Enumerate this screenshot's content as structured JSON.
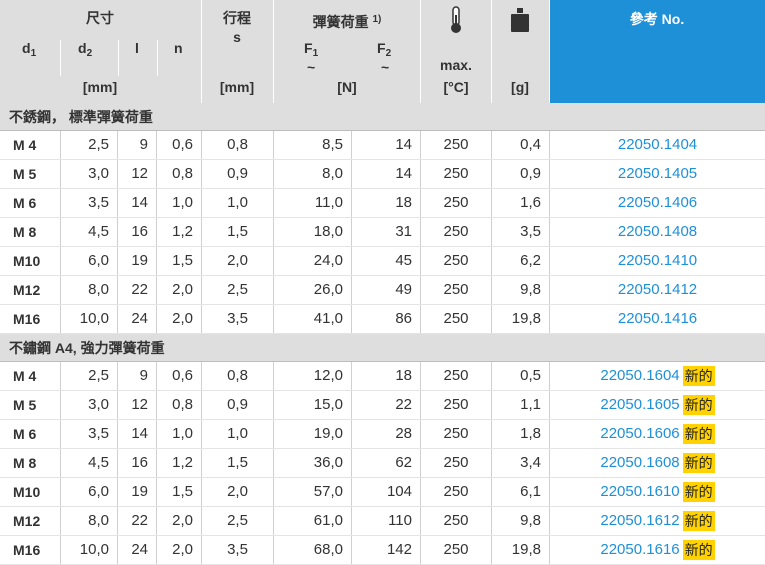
{
  "header": {
    "dim_group": "尺寸",
    "d1": "d",
    "d1_sub": "1",
    "d2": "d",
    "d2_sub": "2",
    "l": "l",
    "n": "n",
    "mm_unit": "[mm]",
    "stroke_title": "行程",
    "stroke_sym": "s",
    "stroke_unit": "[mm]",
    "spring_title": "彈簧荷重",
    "spring_sup": "1)",
    "f1": "F",
    "f1_sub": "1",
    "f1_tilde": "~",
    "f2": "F",
    "f2_sub": "2",
    "f2_tilde": "~",
    "n_unit": "[N]",
    "max_label": "max.",
    "temp_unit": "[°C]",
    "weight_unit": "[g]",
    "ref_title": "參考 No.",
    "temp_icon": "thermometer-icon",
    "weight_icon": "weight-icon"
  },
  "new_badge": "新的",
  "sections": [
    {
      "title": "不銹鋼， 標準彈簧荷重",
      "rows": [
        {
          "size": "M 4",
          "d2": "2,5",
          "l": "9",
          "n": "0,6",
          "s": "0,8",
          "f1": "8,5",
          "f2": "14",
          "t": "250",
          "g": "0,4",
          "ref": "22050.1404",
          "new": false
        },
        {
          "size": "M 5",
          "d2": "3,0",
          "l": "12",
          "n": "0,8",
          "s": "0,9",
          "f1": "8,0",
          "f2": "14",
          "t": "250",
          "g": "0,9",
          "ref": "22050.1405",
          "new": false
        },
        {
          "size": "M 6",
          "d2": "3,5",
          "l": "14",
          "n": "1,0",
          "s": "1,0",
          "f1": "11,0",
          "f2": "18",
          "t": "250",
          "g": "1,6",
          "ref": "22050.1406",
          "new": false
        },
        {
          "size": "M 8",
          "d2": "4,5",
          "l": "16",
          "n": "1,2",
          "s": "1,5",
          "f1": "18,0",
          "f2": "31",
          "t": "250",
          "g": "3,5",
          "ref": "22050.1408",
          "new": false
        },
        {
          "size": "M10",
          "d2": "6,0",
          "l": "19",
          "n": "1,5",
          "s": "2,0",
          "f1": "24,0",
          "f2": "45",
          "t": "250",
          "g": "6,2",
          "ref": "22050.1410",
          "new": false
        },
        {
          "size": "M12",
          "d2": "8,0",
          "l": "22",
          "n": "2,0",
          "s": "2,5",
          "f1": "26,0",
          "f2": "49",
          "t": "250",
          "g": "9,8",
          "ref": "22050.1412",
          "new": false
        },
        {
          "size": "M16",
          "d2": "10,0",
          "l": "24",
          "n": "2,0",
          "s": "3,5",
          "f1": "41,0",
          "f2": "86",
          "t": "250",
          "g": "19,8",
          "ref": "22050.1416",
          "new": false
        }
      ]
    },
    {
      "title": "不鏽鋼 A4, 強力彈簧荷重",
      "rows": [
        {
          "size": "M 4",
          "d2": "2,5",
          "l": "9",
          "n": "0,6",
          "s": "0,8",
          "f1": "12,0",
          "f2": "18",
          "t": "250",
          "g": "0,5",
          "ref": "22050.1604",
          "new": true
        },
        {
          "size": "M 5",
          "d2": "3,0",
          "l": "12",
          "n": "0,8",
          "s": "0,9",
          "f1": "15,0",
          "f2": "22",
          "t": "250",
          "g": "1,1",
          "ref": "22050.1605",
          "new": true
        },
        {
          "size": "M 6",
          "d2": "3,5",
          "l": "14",
          "n": "1,0",
          "s": "1,0",
          "f1": "19,0",
          "f2": "28",
          "t": "250",
          "g": "1,8",
          "ref": "22050.1606",
          "new": true
        },
        {
          "size": "M 8",
          "d2": "4,5",
          "l": "16",
          "n": "1,2",
          "s": "1,5",
          "f1": "36,0",
          "f2": "62",
          "t": "250",
          "g": "3,4",
          "ref": "22050.1608",
          "new": true
        },
        {
          "size": "M10",
          "d2": "6,0",
          "l": "19",
          "n": "1,5",
          "s": "2,0",
          "f1": "57,0",
          "f2": "104",
          "t": "250",
          "g": "6,1",
          "ref": "22050.1610",
          "new": true
        },
        {
          "size": "M12",
          "d2": "8,0",
          "l": "22",
          "n": "2,0",
          "s": "2,5",
          "f1": "61,0",
          "f2": "110",
          "t": "250",
          "g": "9,8",
          "ref": "22050.1612",
          "new": true
        },
        {
          "size": "M16",
          "d2": "10,0",
          "l": "24",
          "n": "2,0",
          "s": "3,5",
          "f1": "68,0",
          "f2": "142",
          "t": "250",
          "g": "19,8",
          "ref": "22050.1616",
          "new": true
        }
      ]
    }
  ]
}
